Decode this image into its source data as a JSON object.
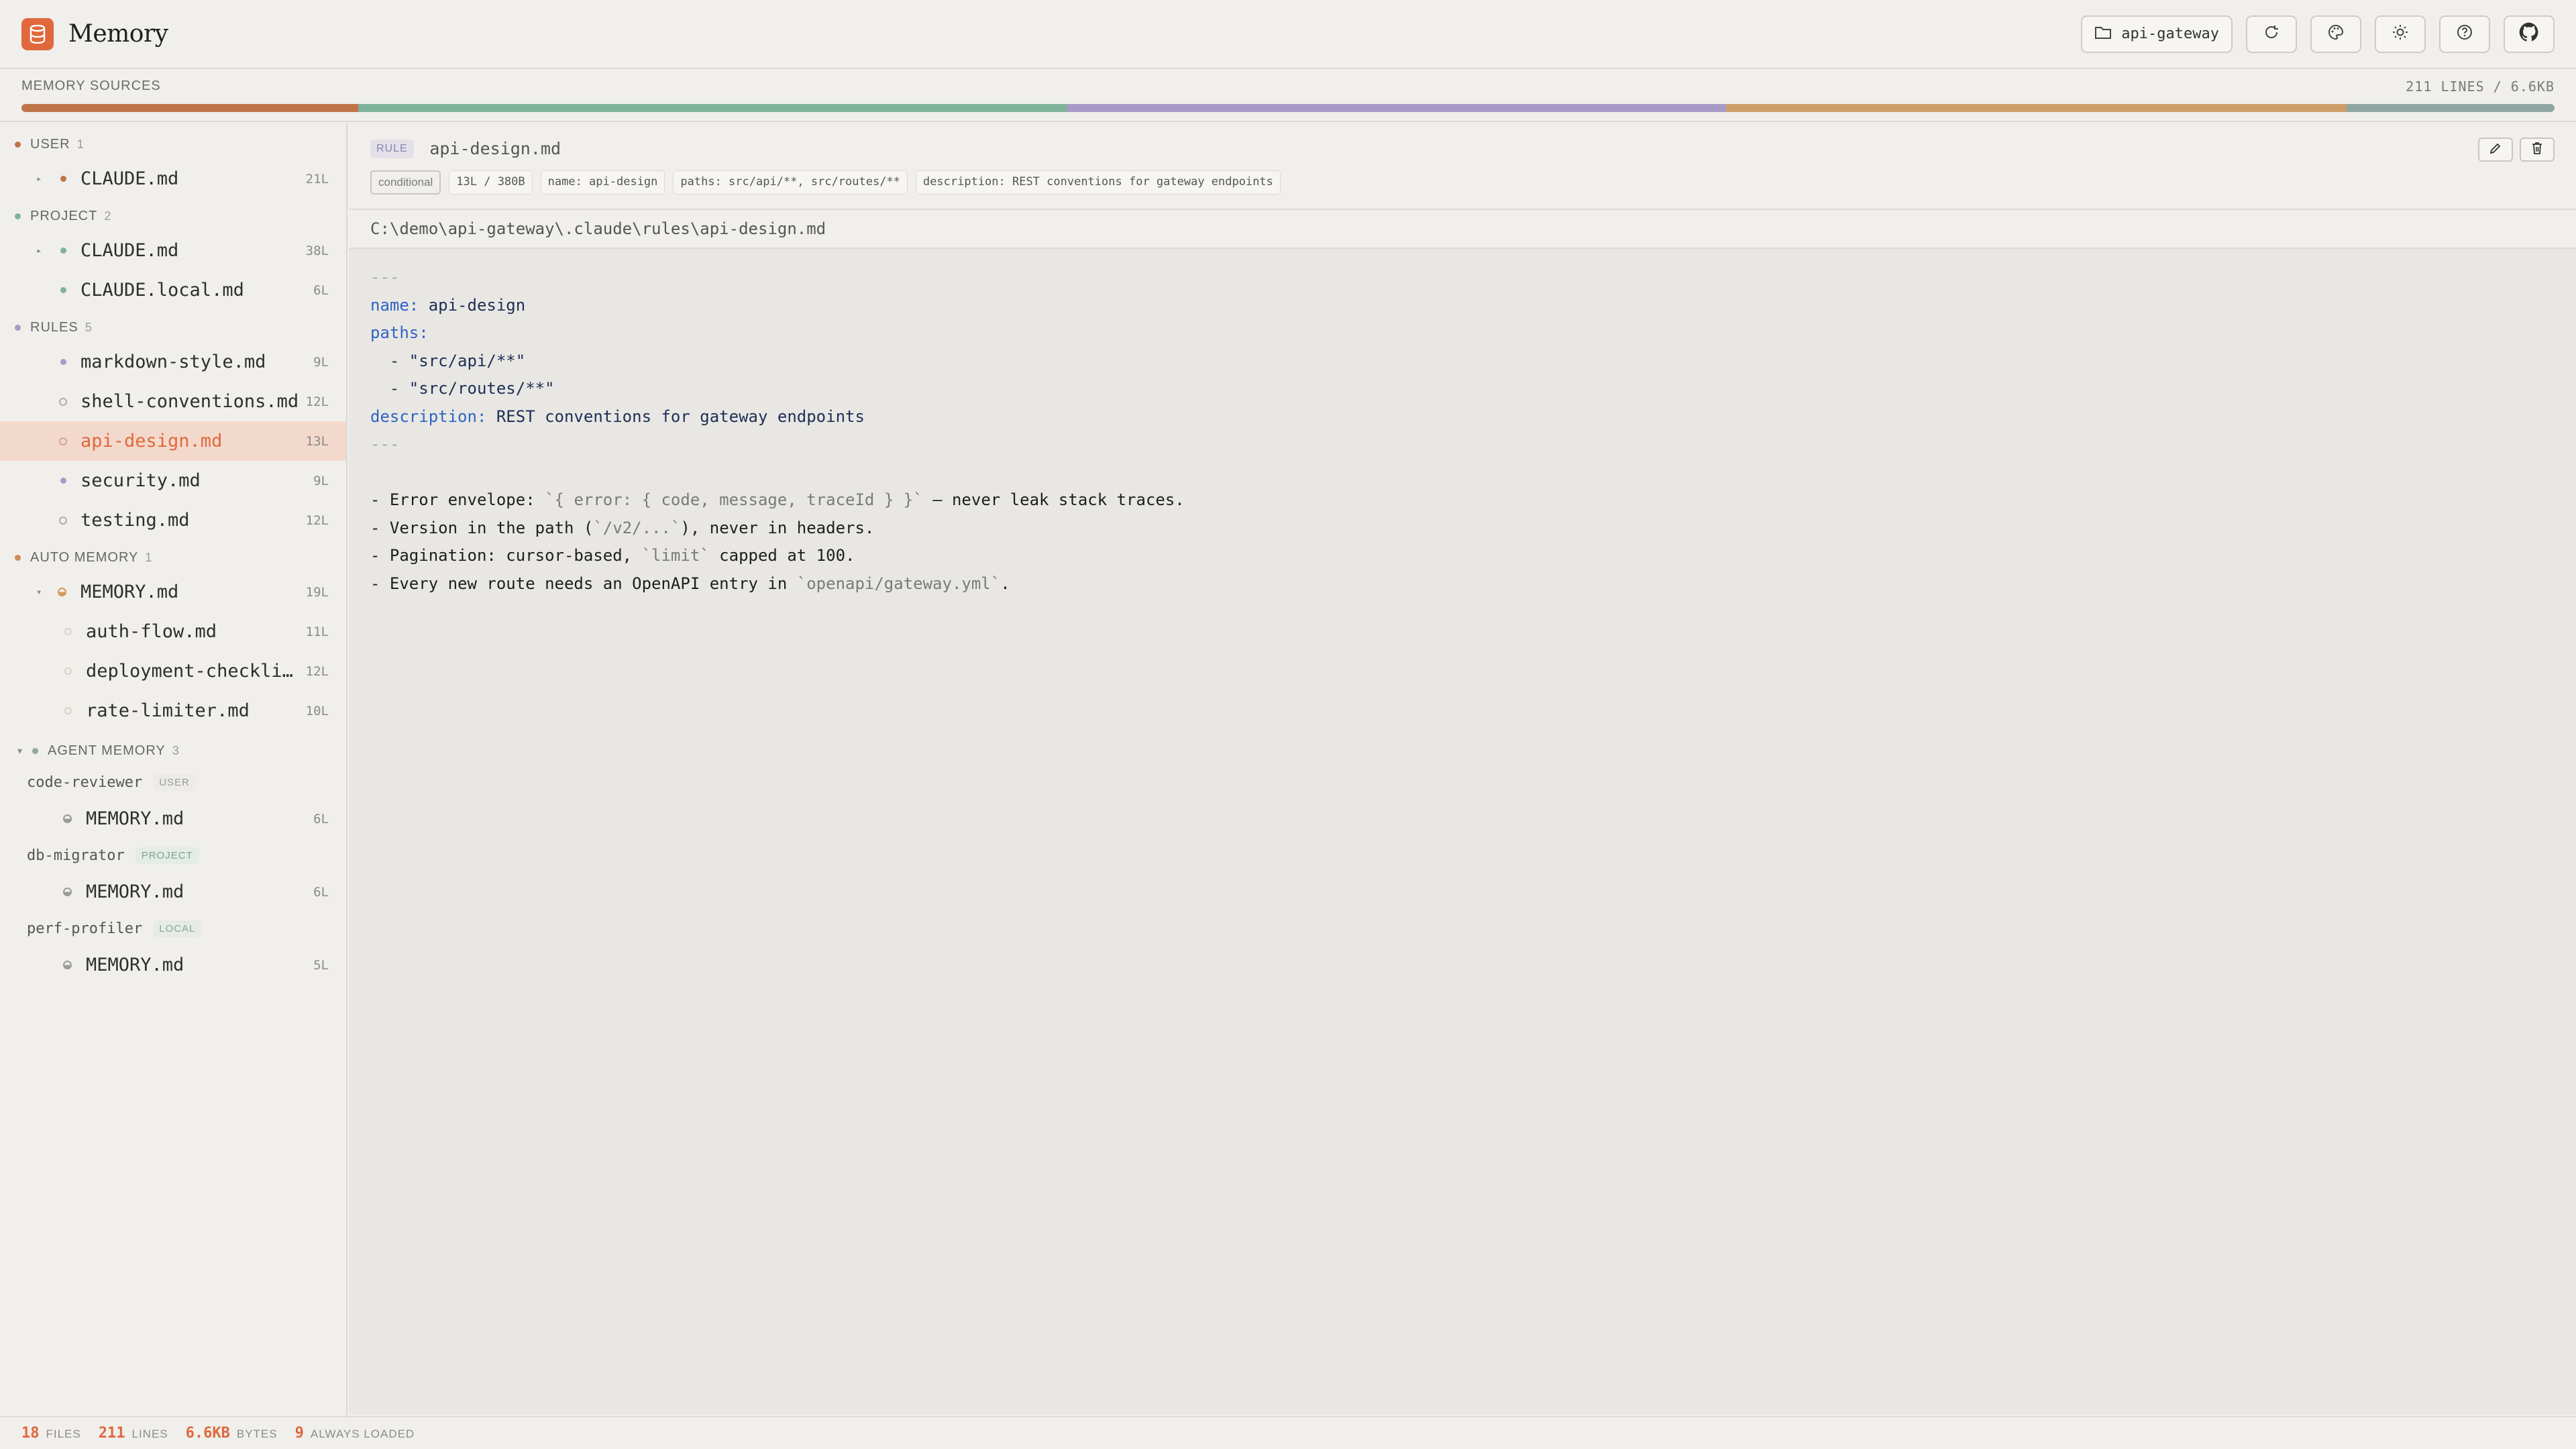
{
  "app": {
    "title": "Memory",
    "project_button": "api-gateway"
  },
  "colors": {
    "accent": "#e0683c",
    "user": "#c0744a",
    "project": "#7fb29b",
    "rules": "#a89ac6",
    "auto": "#cf9d6b",
    "agent": "#8fa6a0"
  },
  "sources": {
    "label": "MEMORY SOURCES",
    "meta": "211 LINES / 6.6KB",
    "segments": [
      {
        "name": "user",
        "fraction": 0.133,
        "color": "#c0744a"
      },
      {
        "name": "project",
        "fraction": 0.28,
        "color": "#7fb29b"
      },
      {
        "name": "rules",
        "fraction": 0.26,
        "color": "#a89ac6"
      },
      {
        "name": "auto-memory",
        "fraction": 0.245,
        "color": "#cf9d6b"
      },
      {
        "name": "agent-memory",
        "fraction": 0.082,
        "color": "#8fa6a0"
      }
    ]
  },
  "sidebar": {
    "user": {
      "label": "USER",
      "count": "1",
      "items": [
        {
          "name": "CLAUDE.md",
          "lines": "21L"
        }
      ]
    },
    "project": {
      "label": "PROJECT",
      "count": "2",
      "items": [
        {
          "name": "CLAUDE.md",
          "lines": "38L"
        },
        {
          "name": "CLAUDE.local.md",
          "lines": "6L"
        }
      ]
    },
    "rules": {
      "label": "RULES",
      "count": "5",
      "items": [
        {
          "name": "markdown-style.md",
          "lines": "9L"
        },
        {
          "name": "shell-conventions.md",
          "lines": "12L"
        },
        {
          "name": "api-design.md",
          "lines": "13L"
        },
        {
          "name": "security.md",
          "lines": "9L"
        },
        {
          "name": "testing.md",
          "lines": "12L"
        }
      ]
    },
    "auto": {
      "label": "AUTO MEMORY",
      "count": "1",
      "items": [
        {
          "name": "MEMORY.md",
          "lines": "19L"
        },
        {
          "name": "auth-flow.md",
          "lines": "11L"
        },
        {
          "name": "deployment-checklis…",
          "lines": "12L"
        },
        {
          "name": "rate-limiter.md",
          "lines": "10L"
        }
      ]
    },
    "agent": {
      "label": "AGENT MEMORY",
      "count": "3",
      "agents": [
        {
          "name": "code-reviewer",
          "badge": "USER",
          "file": "MEMORY.md",
          "lines": "6L"
        },
        {
          "name": "db-migrator",
          "badge": "PROJECT",
          "file": "MEMORY.md",
          "lines": "6L"
        },
        {
          "name": "perf-profiler",
          "badge": "LOCAL",
          "file": "MEMORY.md",
          "lines": "5L"
        }
      ]
    }
  },
  "file": {
    "tag": "RULE",
    "title": "api-design.md",
    "chips": [
      "conditional",
      "13L / 380B",
      "name: api-design",
      "paths: src/api/**, src/routes/**",
      "description: REST conventions for gateway endpoints"
    ],
    "path": "C:\\demo\\api-gateway\\.claude\\rules\\api-design.md",
    "code": {
      "dash": "---",
      "name_key": "name:",
      "name_val": " api-design",
      "paths_key": "paths:",
      "path1": "  - \"src/api/**\"",
      "path2": "  - \"src/routes/**\"",
      "desc_key": "description:",
      "desc_val": " REST conventions for gateway endpoints",
      "b1a": "- Error envelope: ",
      "b1b": "`{ error: { code, message, traceId } }`",
      "b1c": " — never leak stack traces.",
      "b2a": "- Version in the path (",
      "b2b": "`/v2/...`",
      "b2c": "), never in headers.",
      "b3a": "- Pagination: cursor-based, ",
      "b3b": "`limit`",
      "b3c": " capped at 100.",
      "b4a": "- Every new route needs an OpenAPI entry in ",
      "b4b": "`openapi/gateway.yml`",
      "b4c": "."
    }
  },
  "status": {
    "files_val": "18",
    "files_lab": "FILES",
    "lines_val": "211",
    "lines_lab": "LINES",
    "bytes_val": "6.6KB",
    "bytes_lab": "BYTES",
    "always_val": "9",
    "always_lab": "ALWAYS LOADED"
  }
}
